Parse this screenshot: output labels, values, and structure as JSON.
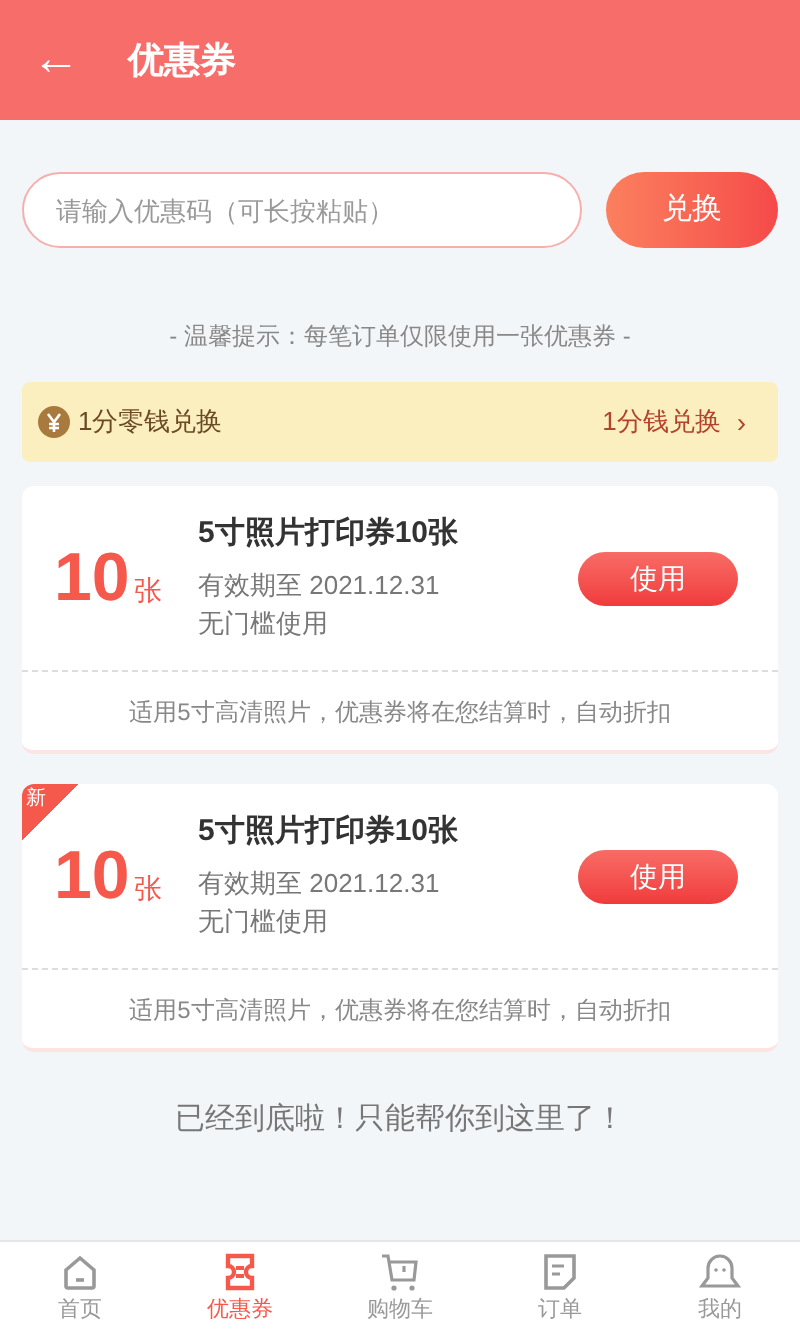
{
  "header": {
    "back_icon": "←",
    "title": "优惠券"
  },
  "redeem": {
    "placeholder": "请输入优惠码（可长按粘贴）",
    "button": "兑换"
  },
  "tip": "- 温馨提示：每笔订单仅限使用一张优惠券 -",
  "exchange_bar": {
    "label": "1分零钱兑换",
    "link": "1分钱兑换",
    "chevron": "›"
  },
  "coupons": [
    {
      "is_new": false,
      "amount": "10",
      "unit": "张",
      "title": "5寸照片打印券10张",
      "validity": "有效期至 2021.12.31",
      "condition": "无门槛使用",
      "button": "使用",
      "note": "适用5寸高清照片，优惠券将在您结算时，自动折扣"
    },
    {
      "is_new": true,
      "badge": "新",
      "amount": "10",
      "unit": "张",
      "title": "5寸照片打印券10张",
      "validity": "有效期至 2021.12.31",
      "condition": "无门槛使用",
      "button": "使用",
      "note": "适用5寸高清照片，优惠券将在您结算时，自动折扣"
    }
  ],
  "end_text": "已经到底啦！只能帮你到这里了！",
  "tabs": [
    {
      "kind": "home",
      "label": "首页",
      "selected": false
    },
    {
      "kind": "coupon",
      "label": "优惠券",
      "selected": true
    },
    {
      "kind": "cart",
      "label": "购物车",
      "selected": false
    },
    {
      "kind": "orders",
      "label": "订单",
      "selected": false
    },
    {
      "kind": "me",
      "label": "我的",
      "selected": false
    }
  ]
}
